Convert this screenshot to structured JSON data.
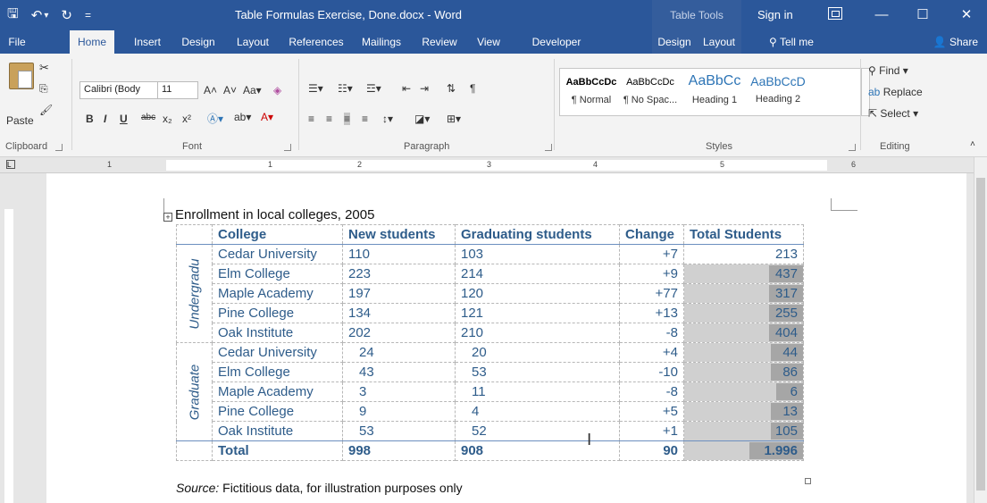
{
  "titlebar": {
    "qat_save": "🖫",
    "qat_undo": "↶",
    "qat_undo_drop": "▾",
    "qat_redo": "↻",
    "qat_custom": "=",
    "doc_title": "Table Formulas Exercise, Done.docx - Word",
    "contextual_title": "Table Tools",
    "signin": "Sign in",
    "minimize": "—",
    "maximize": "☐",
    "close": "✕"
  },
  "tabs": {
    "file": "File",
    "home": "Home",
    "insert": "Insert",
    "design": "Design",
    "layout": "Layout",
    "references": "References",
    "mailings": "Mailings",
    "review": "Review",
    "view": "View",
    "developer": "Developer",
    "tt_design": "Design",
    "tt_layout": "Layout",
    "tell_me": "Tell me",
    "share": "Share"
  },
  "ribbon": {
    "paste": "Paste",
    "clipboard": "Clipboard",
    "font_name": "Calibri (Body",
    "font_size": "11",
    "font": "Font",
    "paragraph": "Paragraph",
    "styles": "Styles",
    "editing": "Editing",
    "find": "Find",
    "replace": "Replace",
    "select": "Select",
    "style_items": [
      {
        "sample": "AaBbCcDc",
        "name": "¶ Normal"
      },
      {
        "sample": "AaBbCcDc",
        "name": "¶ No Spac..."
      },
      {
        "sample": "AaBbCc",
        "name": "Heading 1"
      },
      {
        "sample": "AaBbCcD",
        "name": "Heading 2"
      }
    ],
    "bold": "B",
    "italic": "I",
    "underline": "U",
    "strike": "abc",
    "subscript": "x₂",
    "superscript": "x²"
  },
  "ruler": {
    "tab_marker": "L",
    "numbers": [
      "1",
      "2",
      "3",
      "4",
      "5",
      "6"
    ]
  },
  "document": {
    "caption": "Enrollment in local colleges, 2005",
    "source_label": "Source:",
    "source_text": " Fictitious data, for illustration purposes only",
    "move_handle": "+",
    "headers": [
      "College",
      "New students",
      "Graduating students",
      "Change",
      "Total Students"
    ],
    "groups": [
      {
        "label": "Undergradu",
        "rows": [
          {
            "college": "Cedar University",
            "new": "110",
            "grad": "103",
            "change": "+7",
            "total": "213",
            "bar": 0
          },
          {
            "college": "Elm College",
            "new": "223",
            "grad": "214",
            "change": "+9",
            "total": "437",
            "bar": 1.0
          },
          {
            "college": "Maple Academy",
            "new": "197",
            "grad": "120",
            "change": "+77",
            "total": "317",
            "bar": 1.0
          },
          {
            "college": "Pine College",
            "new": "134",
            "grad": "121",
            "change": "+13",
            "total": "255",
            "bar": 1.0
          },
          {
            "college": "Oak Institute",
            "new": "202",
            "grad": "210",
            "change": "-8",
            "total": "404",
            "bar": 1.0
          }
        ]
      },
      {
        "label": "Graduate",
        "rows": [
          {
            "college": "Cedar University",
            "new": "24",
            "grad": "20",
            "change": "+4",
            "total": "44",
            "bar": 0.95
          },
          {
            "college": "Elm College",
            "new": "43",
            "grad": "53",
            "change": "-10",
            "total": "86",
            "bar": 0.95
          },
          {
            "college": "Maple Academy",
            "new": "3",
            "grad": "11",
            "change": "-8",
            "total": "6",
            "bar": 0.8
          },
          {
            "college": "Pine College",
            "new": "9",
            "grad": "4",
            "change": "+5",
            "total": "13",
            "bar": 0.95
          },
          {
            "college": "Oak Institute",
            "new": "53",
            "grad": "52",
            "change": "+1",
            "total": "105",
            "bar": 0.95
          }
        ]
      }
    ],
    "total": {
      "label": "Total",
      "new": "998",
      "grad": "908",
      "change": "90",
      "total": "1.996",
      "bar": 1.0
    }
  }
}
